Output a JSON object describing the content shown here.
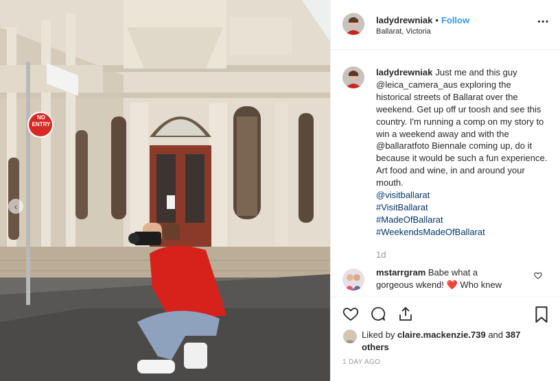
{
  "post": {
    "username": "ladydrewniak",
    "follow_label": "Follow",
    "location": "Ballarat, Victoria",
    "more_label": "•••"
  },
  "photo": {
    "sign_text_line1": "NO",
    "sign_text_line2": "ENTRY",
    "prev_arrow": "‹"
  },
  "caption": {
    "username": "ladydrewniak",
    "text": "Just me and this guy @leica_camera_aus exploring the historical streets of Ballarat over the weekend. Get up off ur toosh and see this country. I'm running a comp on my story to win a weekend away and with the @ballaratfoto Biennale coming up, do it because it would be such a fun experience. Art food and wine, in and around your mouth.",
    "links": [
      "@visitballarat",
      "#VisitBallarat",
      "#MadeOfBallarat",
      "#WeekendsMadeOfBallarat"
    ],
    "age": "1d"
  },
  "comment": {
    "username": "mstarrgram",
    "text": "Babe what a gorgeous wkend! ❤️ Who knew"
  },
  "likes": {
    "prefix": "Liked by",
    "user": "claire.mackenzie.739",
    "suffix": "and",
    "others": "387 others"
  },
  "timestamp": "1 DAY AGO",
  "colors": {
    "accent": "#3897f0",
    "link": "#003569",
    "heart": "#ed4956"
  }
}
